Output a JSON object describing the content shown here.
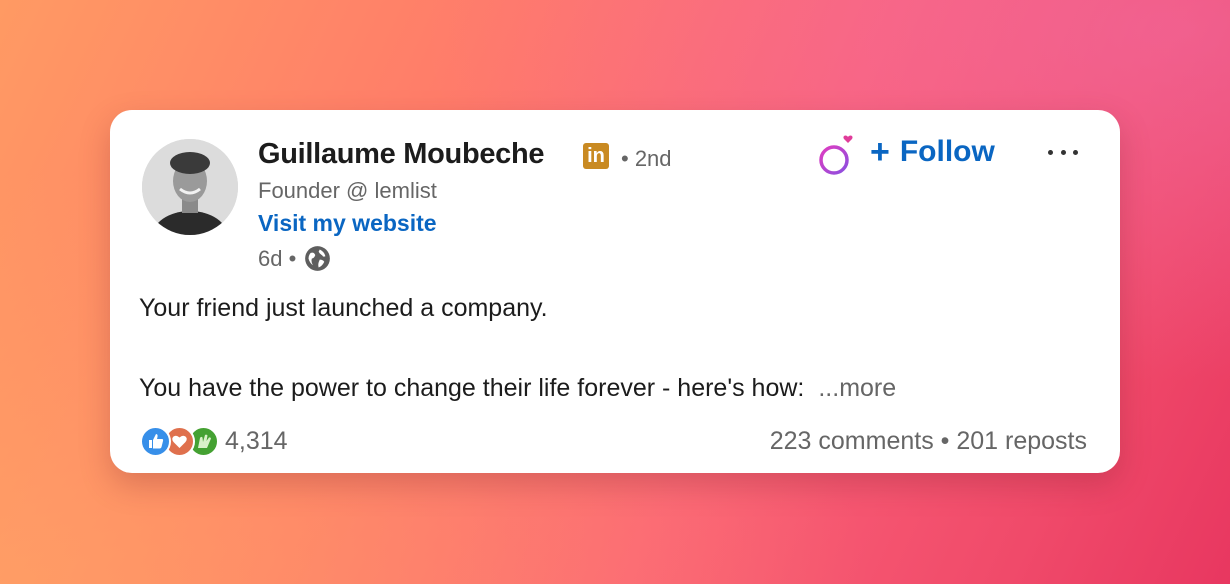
{
  "author": {
    "name": "Guillaume Moubeche",
    "badge_text": "in",
    "degree": "• 2nd",
    "headline": "Founder @ lemlist",
    "website_link": "Visit my website",
    "time_posted": "6d •",
    "visibility_icon": "globe-icon"
  },
  "actions": {
    "ring_icon": "ring-heart-icon",
    "follow_plus": "+",
    "follow_label": "Follow",
    "more_icon": "more-options-icon"
  },
  "post": {
    "line1": "Your friend just launched a company.",
    "line2": "You have the power to change their life forever - here's how:",
    "see_more": "...more"
  },
  "social": {
    "reaction_icons": [
      "like-icon",
      "love-icon",
      "celebrate-icon"
    ],
    "reaction_count": "4,314",
    "counts_text": "223 comments • 201 reposts"
  },
  "colors": {
    "link_blue": "#0a66c2",
    "badge_gold": "#c98a22",
    "muted_gray": "#666666"
  }
}
